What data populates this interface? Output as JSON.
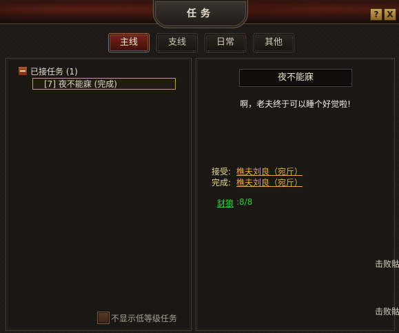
{
  "window": {
    "title": "任务",
    "help_label": "?",
    "close_label": "X"
  },
  "tabs": [
    {
      "label": "主线",
      "active": true
    },
    {
      "label": "支线",
      "active": false
    },
    {
      "label": "日常",
      "active": false
    },
    {
      "label": "其他",
      "active": false
    }
  ],
  "quest_list": {
    "group_label": "已接任务 (1)",
    "items": [
      {
        "label": "[7] 夜不能寐 (完成)"
      }
    ],
    "hide_low_level_label": "不显示低等级任务"
  },
  "quest_detail": {
    "title": "夜不能寐",
    "dialogue": "啊，老夫终于可以睡个好觉啦!",
    "accept_label": "接受:",
    "accept_npc": "樵夫刘良（宛斤）",
    "complete_label": "完成:",
    "complete_npc": "樵夫刘良（宛斤）",
    "objective_name": "豺狼",
    "objective_progress": ":8/8"
  },
  "overflow_text": [
    "击败骷",
    "击败骷"
  ],
  "colors": {
    "accent_tab": "#7a2416",
    "link_orange": "#e8a840",
    "objective_green": "#3fc43f",
    "highlight_border": "#c9a24a"
  }
}
